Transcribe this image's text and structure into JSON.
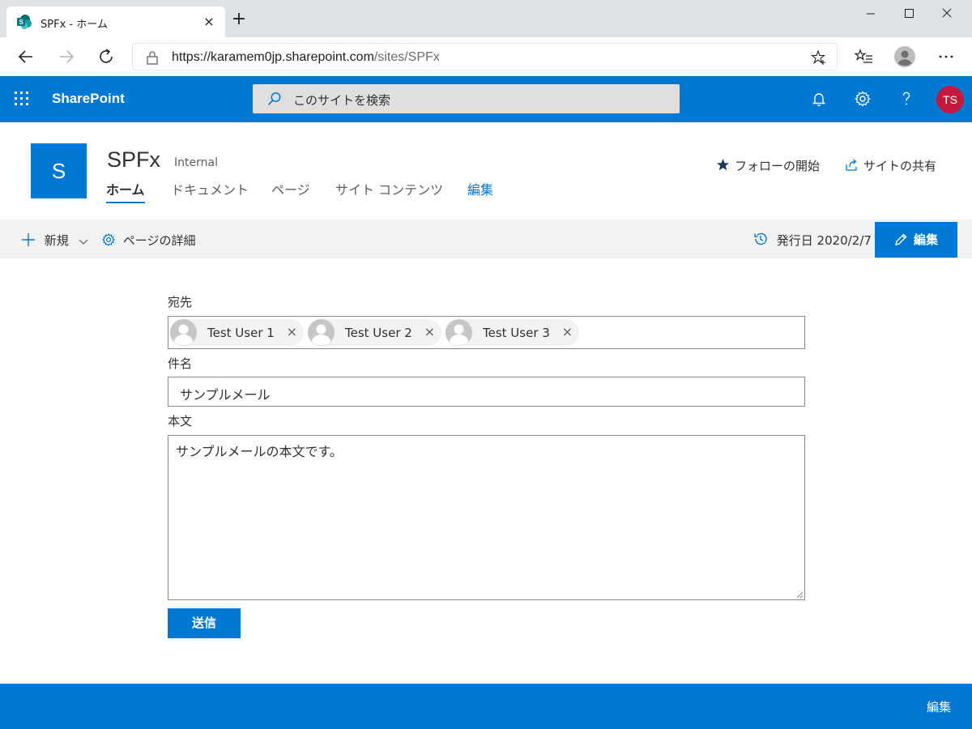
{
  "browser": {
    "tab_title": "SPFx - ホーム",
    "tab_close": "×",
    "new_tab": "+",
    "url_base": "https://karamem0jp.sharepoint.com",
    "url_path": "/sites/SPFx"
  },
  "suitebar": {
    "brand": "SharePoint",
    "search_placeholder": "このサイトを検索",
    "avatar_initials": "TS",
    "accent": "#0078d4"
  },
  "site": {
    "logo_letter": "S",
    "title": "SPFx",
    "classification": "Internal",
    "nav": [
      {
        "label": "ホーム",
        "active": true
      },
      {
        "label": "ドキュメント"
      },
      {
        "label": "ページ"
      },
      {
        "label": "サイト コンテンツ"
      },
      {
        "label": "編集"
      }
    ],
    "follow_label": "フォローの開始",
    "share_label": "サイトの共有"
  },
  "commandbar": {
    "new_label": "新規",
    "page_details_label": "ページの詳細",
    "published_label": "発行日 2020/2/7",
    "edit_label": "編集"
  },
  "form": {
    "to_label": "宛先",
    "recipients": [
      {
        "name": "Test User 1"
      },
      {
        "name": "Test User 2"
      },
      {
        "name": "Test User 3"
      }
    ],
    "remove_glyph": "×",
    "subject_label": "件名",
    "subject_value": "サンプルメール",
    "body_label": "本文",
    "body_value": "サンプルメールの本文です。",
    "send_label": "送信"
  },
  "footer": {
    "edit_label": "編集"
  }
}
